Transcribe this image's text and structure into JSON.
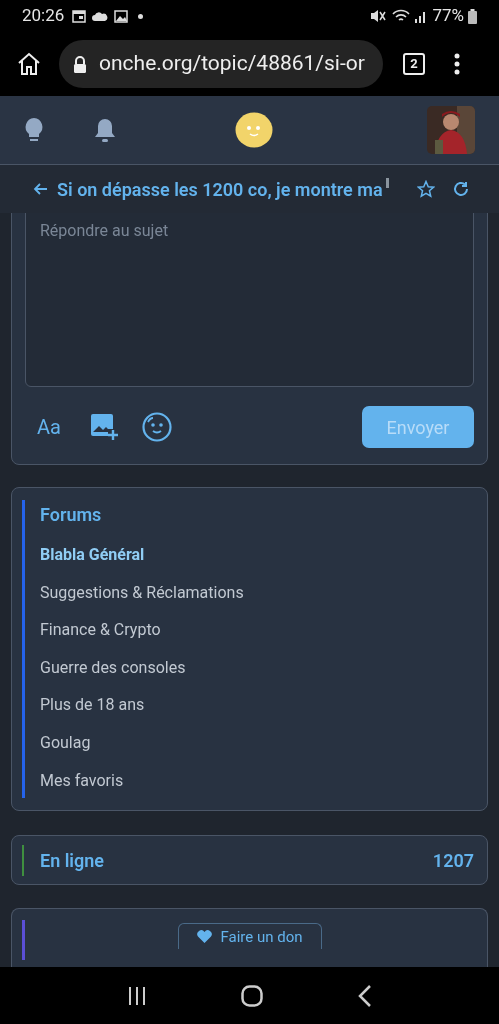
{
  "status_bar": {
    "time": "20:26",
    "battery": "77%"
  },
  "browser": {
    "url": "onche.org/topic/48861/si-or",
    "tab_count": "2"
  },
  "topic_bar": {
    "title": "Si on dépasse les 1200 co, je montre ma"
  },
  "reply": {
    "placeholder": "Répondre au sujet",
    "format_label": "Aa",
    "send_button": "Envoyer",
    "send_disabled": true
  },
  "forums": {
    "title": "Forums",
    "color": "#2563eb",
    "items": [
      {
        "label": "Blabla Général",
        "selected": true
      },
      {
        "label": "Suggestions & Réclamations",
        "selected": false
      },
      {
        "label": "Finance & Crypto",
        "selected": false
      },
      {
        "label": "Guerre des consoles",
        "selected": false
      },
      {
        "label": "Plus de 18 ans",
        "selected": false
      },
      {
        "label": "Goulag",
        "selected": false
      },
      {
        "label": "Mes favoris",
        "selected": false
      }
    ]
  },
  "online": {
    "label": "En ligne",
    "count": "1207",
    "color": "#3f8f3f"
  },
  "donate": {
    "button": "Faire un don",
    "color": "#5b4fd6"
  }
}
